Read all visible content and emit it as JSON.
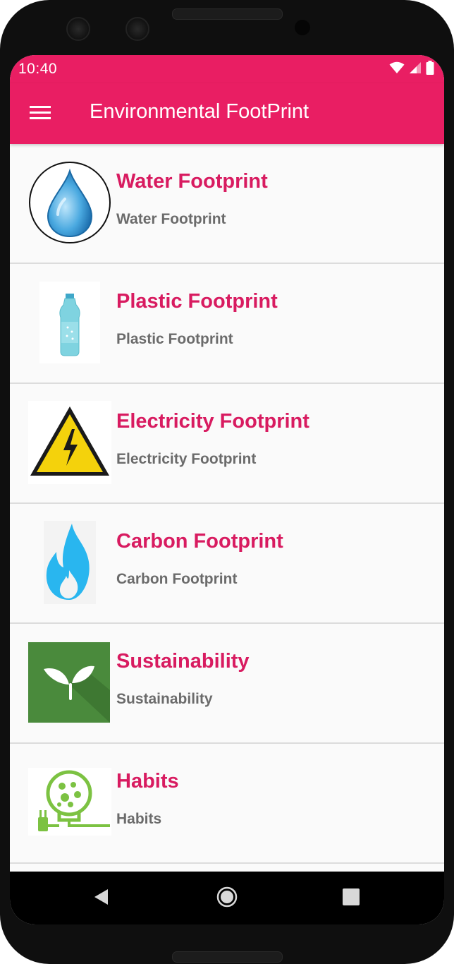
{
  "status_bar": {
    "time": "10:40",
    "icons": [
      "wifi-icon",
      "signal-icon",
      "battery-icon"
    ]
  },
  "app_bar": {
    "title": "Environmental FootPrint",
    "menu_icon": "hamburger-menu-icon",
    "color": "#e91e63"
  },
  "items": [
    {
      "title": "Water Footprint",
      "subtitle": "Water Footprint",
      "icon": "water-drop-icon"
    },
    {
      "title": "Plastic Footprint",
      "subtitle": "Plastic Footprint",
      "icon": "plastic-bottle-icon"
    },
    {
      "title": "Electricity Footprint",
      "subtitle": "Electricity Footprint",
      "icon": "high-voltage-icon"
    },
    {
      "title": "Carbon Footprint",
      "subtitle": "Carbon Footprint",
      "icon": "flame-icon"
    },
    {
      "title": "Sustainability",
      "subtitle": "Sustainability",
      "icon": "sprout-icon"
    },
    {
      "title": "Habits",
      "subtitle": "Habits",
      "icon": "eco-bulb-icon"
    }
  ],
  "nav_bar": {
    "buttons": [
      "back-icon",
      "home-icon",
      "recents-icon"
    ]
  },
  "colors": {
    "accent": "#e91e63",
    "title_text": "#d81b60",
    "subtitle_text": "#6b6b6b"
  }
}
